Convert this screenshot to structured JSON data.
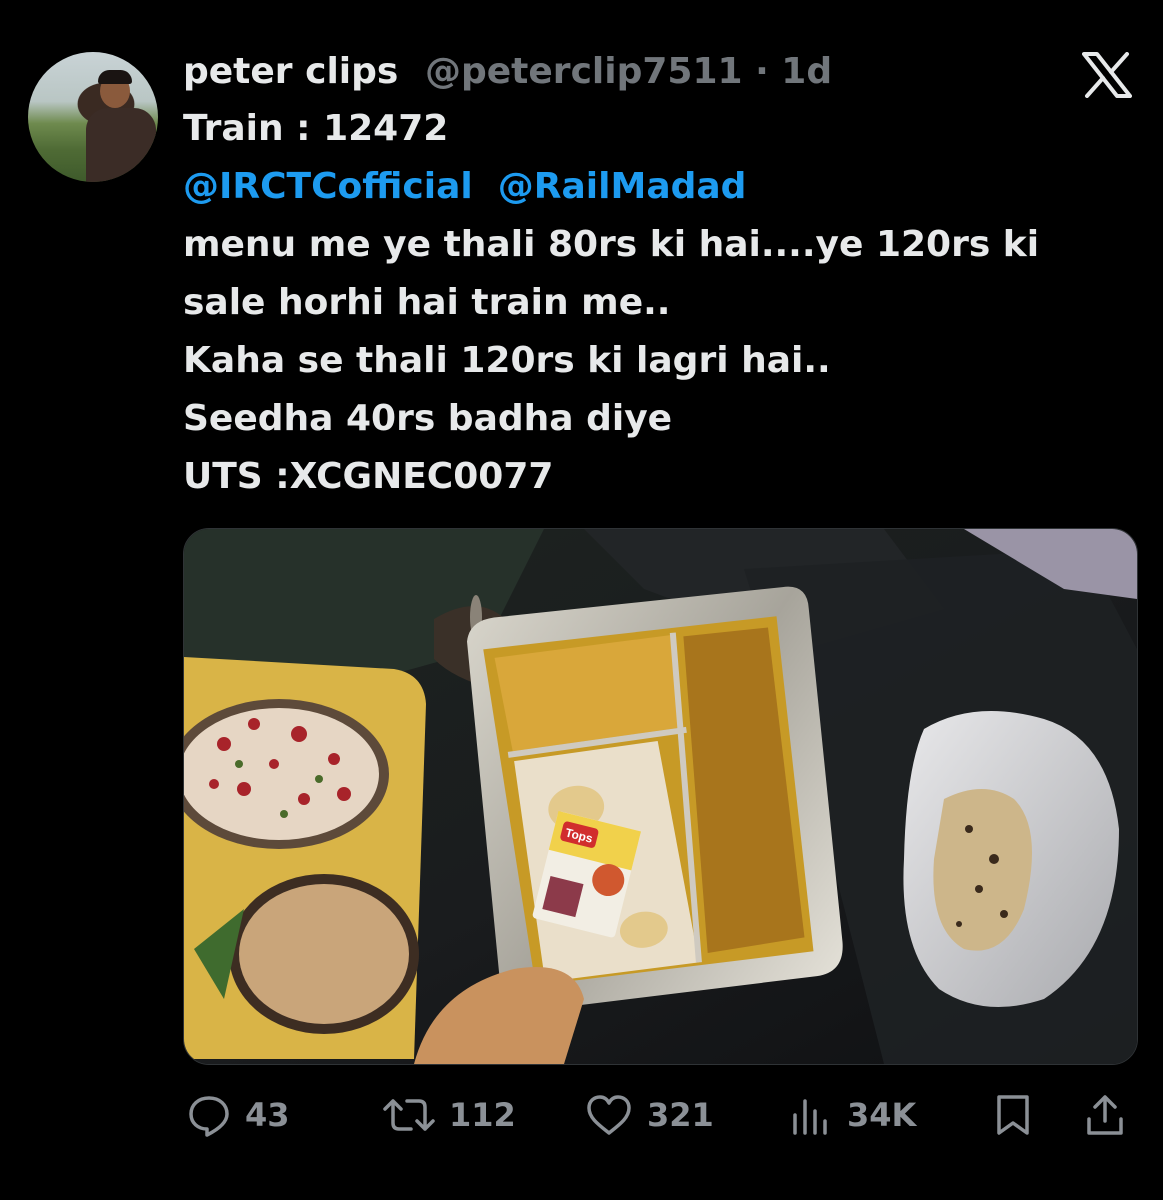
{
  "tweet": {
    "author": {
      "name": "peter clips",
      "handle_time": "@peterclip7511 · 1d"
    },
    "lines": {
      "train": "Train : 12472",
      "mention_1": "@IRCTCofficial",
      "mention_2": "@RailMadad",
      "line_1": "menu me ye thali 80rs ki hai....ye 120rs ki",
      "line_2": "sale horhi hai train me..",
      "line_3": "Kaha se thali 120rs ki lagri hai..",
      "line_4": "Seedha 40rs badha diye",
      "line_5": "UTS :XCGNEC0077"
    },
    "media": {
      "packet_brand": "Tops"
    },
    "actions": {
      "replies": "43",
      "reposts": "112",
      "likes": "321",
      "views": "34K"
    }
  },
  "colors": {
    "background": "#000000",
    "text": "#e7e9ea",
    "muted": "#71767b",
    "mention": "#1d9bf0"
  },
  "icons": [
    "x-logo-icon",
    "reply-icon",
    "repost-icon",
    "like-icon",
    "views-icon",
    "bookmark-icon",
    "share-icon"
  ]
}
